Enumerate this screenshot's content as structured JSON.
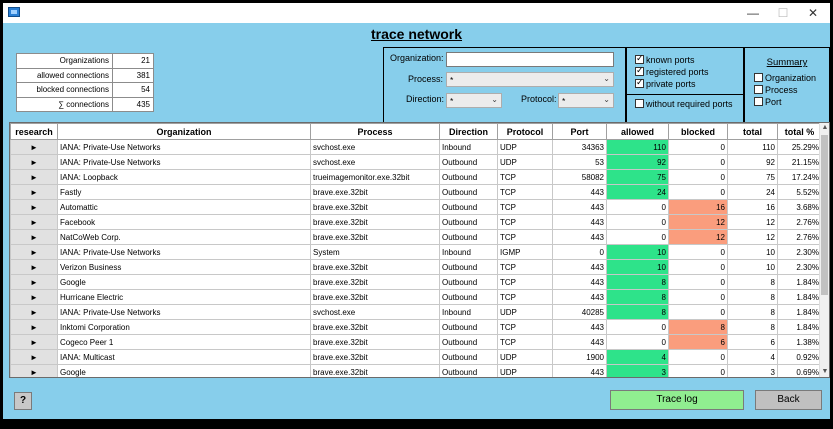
{
  "window": {
    "minimize": "—",
    "maximize": "☐",
    "close": "✕"
  },
  "title": "trace network",
  "stats": [
    {
      "label": "Organizations",
      "value": "21"
    },
    {
      "label": "allowed connections",
      "value": "381"
    },
    {
      "label": "blocked connections",
      "value": "54"
    },
    {
      "label": "∑ connections",
      "value": "435"
    }
  ],
  "filters": {
    "organization_label": "Organization:",
    "organization_value": "",
    "process_label": "Process:",
    "process_value": "*",
    "direction_label": "Direction:",
    "direction_value": "*",
    "protocol_label": "Protocol:",
    "protocol_value": "*"
  },
  "ports": {
    "known": {
      "label": "known ports",
      "checked": true
    },
    "registered": {
      "label": "registered ports",
      "checked": true
    },
    "private": {
      "label": "private ports",
      "checked": true
    },
    "without_required": {
      "label": "without required ports",
      "checked": false
    }
  },
  "summary": {
    "title": "Summary",
    "organization": {
      "label": "Organization",
      "checked": false
    },
    "process": {
      "label": "Process",
      "checked": false
    },
    "port": {
      "label": "Port",
      "checked": false
    }
  },
  "table": {
    "columns": [
      "research",
      "Organization",
      "Process",
      "Direction",
      "Protocol",
      "Port",
      "allowed",
      "blocked",
      "total",
      "total %"
    ],
    "research_glyph": "►",
    "rows": [
      [
        "IANA:  Private-Use Networks",
        "svchost.exe",
        "Inbound",
        "UDP",
        "34363",
        "110",
        "0",
        "110",
        "25.29%"
      ],
      [
        "IANA:  Private-Use Networks",
        "svchost.exe",
        "Outbound",
        "UDP",
        "53",
        "92",
        "0",
        "92",
        "21.15%"
      ],
      [
        "IANA:  Loopback",
        "trueimagemonitor.exe.32bit",
        "Outbound",
        "TCP",
        "58082",
        "75",
        "0",
        "75",
        "17.24%"
      ],
      [
        "Fastly",
        "brave.exe.32bit",
        "Outbound",
        "TCP",
        "443",
        "24",
        "0",
        "24",
        "5.52%"
      ],
      [
        "Automattic",
        "brave.exe.32bit",
        "Outbound",
        "TCP",
        "443",
        "0",
        "16",
        "16",
        "3.68%"
      ],
      [
        "Facebook",
        "brave.exe.32bit",
        "Outbound",
        "TCP",
        "443",
        "0",
        "12",
        "12",
        "2.76%"
      ],
      [
        "NatCoWeb Corp.",
        "brave.exe.32bit",
        "Outbound",
        "TCP",
        "443",
        "0",
        "12",
        "12",
        "2.76%"
      ],
      [
        "IANA:  Private-Use Networks",
        "System",
        "Inbound",
        "IGMP",
        "0",
        "10",
        "0",
        "10",
        "2.30%"
      ],
      [
        "Verizon Business",
        "brave.exe.32bit",
        "Outbound",
        "TCP",
        "443",
        "10",
        "0",
        "10",
        "2.30%"
      ],
      [
        "Google",
        "brave.exe.32bit",
        "Outbound",
        "TCP",
        "443",
        "8",
        "0",
        "8",
        "1.84%"
      ],
      [
        "Hurricane Electric",
        "brave.exe.32bit",
        "Outbound",
        "TCP",
        "443",
        "8",
        "0",
        "8",
        "1.84%"
      ],
      [
        "IANA:  Private-Use Networks",
        "svchost.exe",
        "Inbound",
        "UDP",
        "40285",
        "8",
        "0",
        "8",
        "1.84%"
      ],
      [
        "Inktomi Corporation",
        "brave.exe.32bit",
        "Outbound",
        "TCP",
        "443",
        "0",
        "8",
        "8",
        "1.84%"
      ],
      [
        "Cogeco Peer 1",
        "brave.exe.32bit",
        "Outbound",
        "TCP",
        "443",
        "0",
        "6",
        "6",
        "1.38%"
      ],
      [
        "IANA:  Multicast",
        "brave.exe.32bit",
        "Outbound",
        "UDP",
        "1900",
        "4",
        "0",
        "4",
        "0.92%"
      ],
      [
        "Google",
        "brave.exe.32bit",
        "Outbound",
        "UDP",
        "443",
        "3",
        "0",
        "3",
        "0.69%"
      ]
    ]
  },
  "buttons": {
    "help": "?",
    "trace_log": "Trace log",
    "back": "Back"
  },
  "colors": {
    "background": "#87ceeb",
    "allowed_highlight": "#2ee38a",
    "blocked_highlight": "#fa9d7d",
    "trace_log_button": "#90ee90"
  }
}
